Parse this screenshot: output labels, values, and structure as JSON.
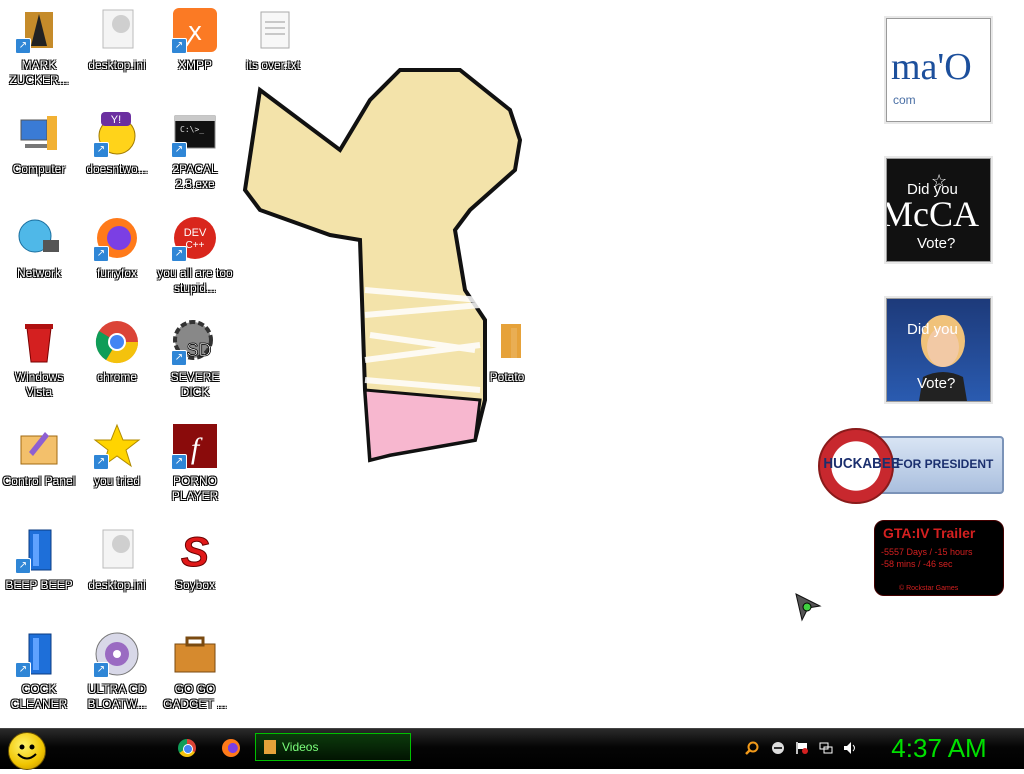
{
  "desktop": {
    "icons": [
      {
        "label": "MARK ZUCKER..."
      },
      {
        "label": "desktop.ini"
      },
      {
        "label": "XMPP"
      },
      {
        "label": "its over.txt"
      },
      {
        "label": "Computer"
      },
      {
        "label": "doesntwo..."
      },
      {
        "label": "2PACAL 2.3.exe"
      },
      {
        "label": "Network"
      },
      {
        "label": "furryfox"
      },
      {
        "label": "you all are too stupid..."
      },
      {
        "label": "Windows Vista"
      },
      {
        "label": "chrome"
      },
      {
        "label": "SEVERE DICK"
      },
      {
        "label": "Potato"
      },
      {
        "label": "Control Panel"
      },
      {
        "label": "you tried"
      },
      {
        "label": "PORNO PLAYER"
      },
      {
        "label": "BEEP BEEP"
      },
      {
        "label": "desktop.ini"
      },
      {
        "label": "Soybox"
      },
      {
        "label": "COCK CLEANER"
      },
      {
        "label": "ULTRA CD BLOATW..."
      },
      {
        "label": "GO GO GADGET ..."
      }
    ]
  },
  "gadgets": {
    "mao": {
      "big": "ma'O",
      "small": "com"
    },
    "mccain": {
      "line1": "Did you",
      "big": "McCA",
      "line2": "Vote?"
    },
    "hillary": {
      "line1": "Did you",
      "line2": "Vote?"
    },
    "huckabee": {
      "name": "HUCKABEE",
      "suffix": "FOR PRESIDENT"
    },
    "gta": {
      "title": "GTA:IV Trailer",
      "line1": "-5557 Days / -15 hours",
      "line2": "-58 mins / -46 sec",
      "footer": "© Rockstar Games"
    }
  },
  "taskbar": {
    "window_button": "Videos",
    "clock": "4:37 AM"
  },
  "colors": {
    "taskbar_bg": "#000000",
    "clock": "#00e000",
    "accent_green": "#00c000"
  }
}
